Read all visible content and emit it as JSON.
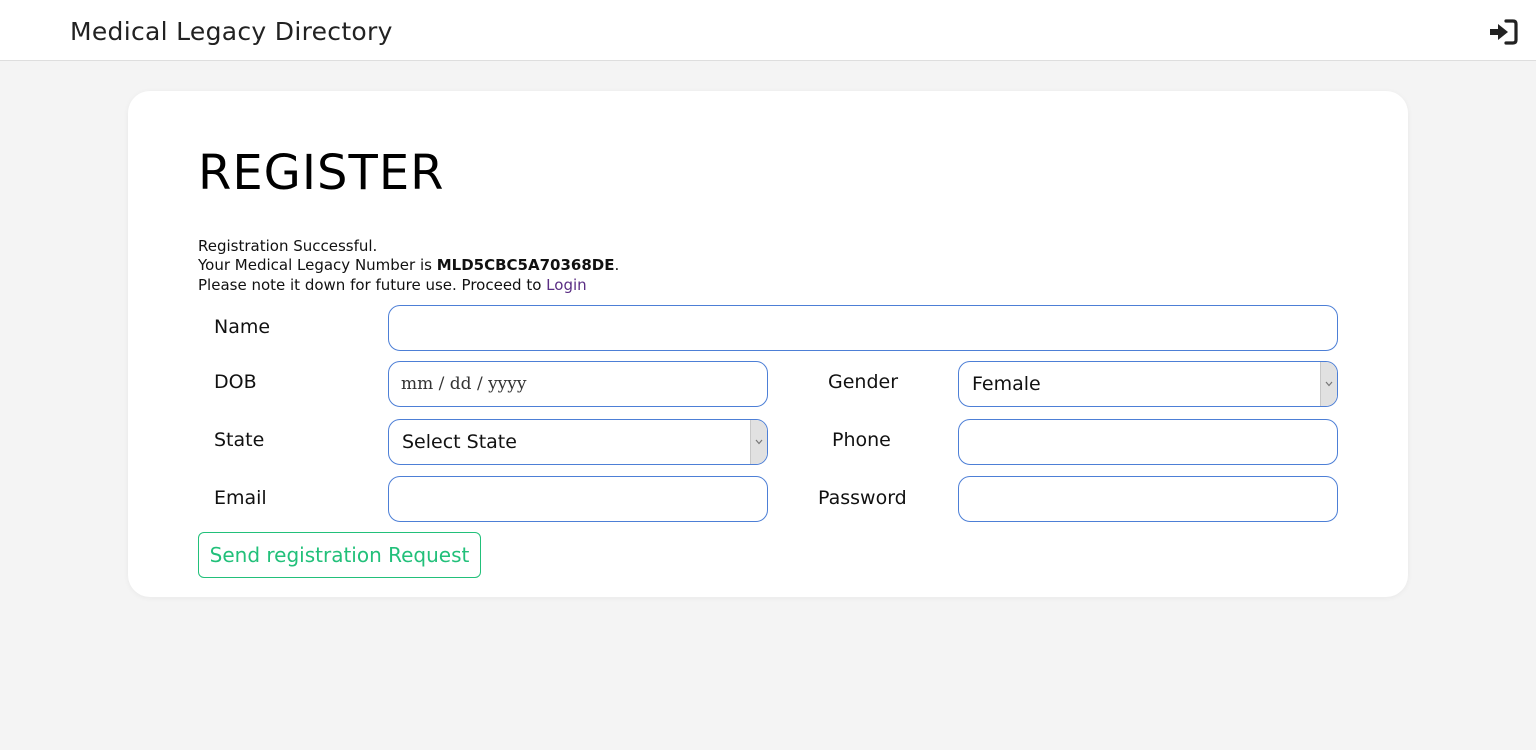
{
  "header": {
    "title": "Medical Legacy Directory",
    "login_icon": "sign-in-icon"
  },
  "page": {
    "heading": "REGISTER"
  },
  "message": {
    "line1": "Registration Successful.",
    "line2_prefix": "Your Medical Legacy Number is ",
    "legacy_number": "MLD5CBC5A70368DE",
    "line2_suffix": ".",
    "line3_prefix": "Please note it down for future use. Proceed to ",
    "login_link": "Login"
  },
  "form": {
    "name_label": "Name",
    "name_value": "",
    "dob_label": "DOB",
    "dob_placeholder": "mm / dd / yyyy",
    "gender_label": "Gender",
    "gender_value": "Female",
    "state_label": "State",
    "state_value": "Select State",
    "phone_label": "Phone",
    "phone_value": "",
    "email_label": "Email",
    "email_value": "",
    "password_label": "Password",
    "password_value": "",
    "submit_label": "Send registration Request"
  },
  "colors": {
    "accent_green": "#22c07a",
    "field_border": "#4d7fd6",
    "link": "#5a2e84"
  }
}
